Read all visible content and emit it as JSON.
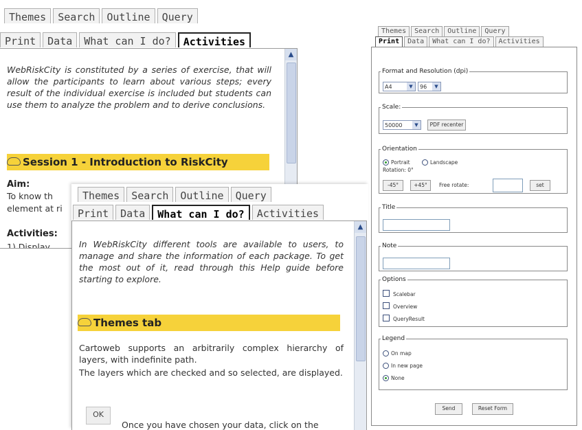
{
  "panel_activities": {
    "tabs_row1": [
      "Themes",
      "Search",
      "Outline",
      "Query"
    ],
    "tabs_row2": [
      "Print",
      "Data",
      "What can I do?",
      "Activities"
    ],
    "active_tab": "Activities",
    "intro": "WebRiskCity is constituted by a series of exercise, that will allow the participants to learn about various steps; every result of the individual exercise is included but students can use them to analyze the problem and to derive conclusions.",
    "session_title": "Session 1 - Introduction to RiskCity",
    "aim_label": "Aim:",
    "aim_text_1": "To know th",
    "aim_text_2": "element at ri",
    "activities_label": "Activities:",
    "activities_item": "1) Display"
  },
  "panel_whatcanido": {
    "tabs_row1": [
      "Themes",
      "Search",
      "Outline",
      "Query"
    ],
    "tabs_row2": [
      "Print",
      "Data",
      "What can I do?",
      "Activities"
    ],
    "active_tab": "What can I do?",
    "intro": "In WebRiskCity different tools are available to users, to manage and share the information of each package. To get the most out of it, read through this Help guide before starting to explore.",
    "section_title": "Themes tab",
    "body_1": "Cartoweb supports an arbitrarily complex hierarchy of layers, with indefinite path.",
    "body_2": "The layers which are checked and so selected, are displayed.",
    "ok_button": "OK",
    "ok_text": "Once you have chosen your data, click on the"
  },
  "panel_print": {
    "tabs_row1": [
      "Themes",
      "Search",
      "Outline",
      "Query"
    ],
    "tabs_row2": [
      "Print",
      "Data",
      "What can I do?",
      "Activities"
    ],
    "active_tab": "Print",
    "format_legend": "Format and Resolution (dpi)",
    "format_value": "A4",
    "dpi_value": "96",
    "scale_legend": "Scale:",
    "scale_value": "50000",
    "pdf_button": "PDF recenter",
    "orientation_legend": "Orientation",
    "portrait_label": "Portrait",
    "landscape_label": "Landscape",
    "rotation_text": "Rotation: 0°",
    "rot_btn_1": "-45°",
    "rot_btn_2": "+45°",
    "free_rotate_label": "Free rotate:",
    "set_button": "set",
    "title_legend": "Title",
    "note_legend": "Note",
    "options_legend": "Options",
    "options": [
      "Scalebar",
      "Overview",
      "QueryResult"
    ],
    "legend_legend": "Legend",
    "legend_options": [
      "On map",
      "In new page",
      "None"
    ],
    "legend_selected": "None",
    "send_button": "Send",
    "reset_button": "Reset Form"
  },
  "colors": {
    "session_bar": "#f6d23a",
    "border": "#9a9a9a"
  }
}
